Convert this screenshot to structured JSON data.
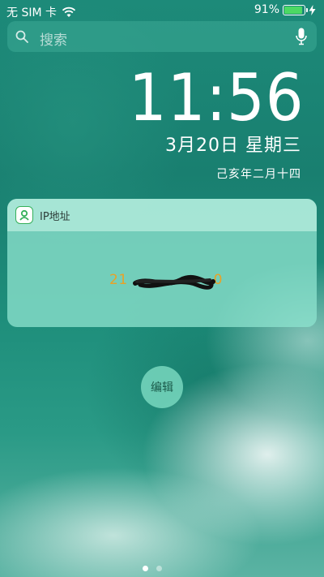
{
  "status_bar": {
    "carrier": "无 SIM 卡",
    "battery_text": "91%",
    "battery_level": 0.91,
    "battery_color": "#4cd964",
    "icons": [
      "wifi-icon",
      "battery-icon",
      "charging-bolt-icon"
    ]
  },
  "search": {
    "placeholder": "搜索",
    "icons": [
      "search-icon",
      "microphone-icon"
    ]
  },
  "lock_screen": {
    "time": "11:56",
    "date": "3月20日 星期三",
    "lunar_date": "己亥年二月十四"
  },
  "widget": {
    "title": "IP地址",
    "value": "21",
    "value_suffix": "0",
    "value_color": "#e8a227",
    "icon": "ip-app-icon"
  },
  "edit_button": {
    "label": "编辑"
  },
  "page_indicator": {
    "count": 2,
    "current": 1
  }
}
